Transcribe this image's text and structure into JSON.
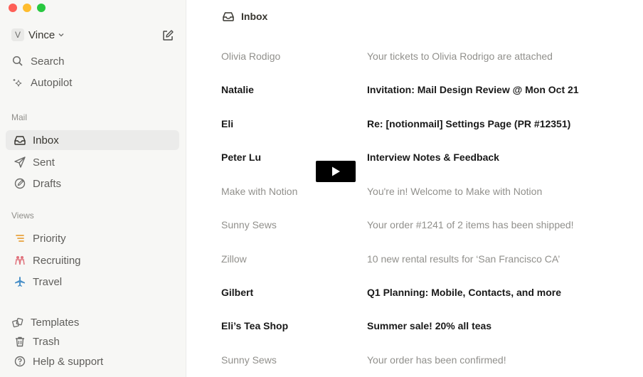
{
  "sidebar": {
    "account": {
      "initial": "V",
      "name": "Vince"
    },
    "top_items": [
      {
        "label": "Search",
        "icon": "search-icon"
      },
      {
        "label": "Autopilot",
        "icon": "sparkle-icon"
      }
    ],
    "mail_section": {
      "label": "Mail",
      "items": [
        {
          "label": "Inbox",
          "icon": "inbox-icon",
          "selected": true
        },
        {
          "label": "Sent",
          "icon": "paper-plane-icon"
        },
        {
          "label": "Drafts",
          "icon": "draft-pencil-icon"
        }
      ]
    },
    "views_section": {
      "label": "Views",
      "items": [
        {
          "label": "Priority",
          "icon": "priority-list-icon",
          "color": "#e8a33d"
        },
        {
          "label": "Recruiting",
          "icon": "people-icon",
          "color": "#e0737d"
        },
        {
          "label": "Travel",
          "icon": "airplane-icon",
          "color": "#4a90c8"
        }
      ]
    },
    "bottom_items": [
      {
        "label": "Templates",
        "icon": "templates-icon"
      },
      {
        "label": "Trash",
        "icon": "trash-icon"
      },
      {
        "label": "Help & support",
        "icon": "help-icon"
      }
    ]
  },
  "main": {
    "title": "Inbox",
    "messages": [
      {
        "sender": "Olivia Rodigo",
        "subject": "Your tickets to Olivia Rodrigo are attached",
        "unread": false
      },
      {
        "sender": "Natalie",
        "subject": "Invitation: Mail Design Review @ Mon Oct 21",
        "unread": true
      },
      {
        "sender": "Eli",
        "subject": "Re: [notionmail] Settings Page (PR #12351)",
        "unread": true
      },
      {
        "sender": "Peter Lu",
        "subject": "Interview Notes & Feedback",
        "unread": true
      },
      {
        "sender": "Make with Notion",
        "subject": "You're in! Welcome to Make with Notion",
        "unread": false
      },
      {
        "sender": "Sunny Sews",
        "subject": "Your order #1241 of 2 items has been shipped!",
        "unread": false
      },
      {
        "sender": "Zillow",
        "subject": "10 new rental results for ‘San Francisco CA’",
        "unread": false
      },
      {
        "sender": "Gilbert",
        "subject": "Q1 Planning: Mobile, Contacts, and more",
        "unread": true
      },
      {
        "sender": "Eli’s Tea Shop",
        "subject": "Summer sale! 20% all teas",
        "unread": true
      },
      {
        "sender": "Sunny Sews",
        "subject": "Your order has been confirmed!",
        "unread": false
      }
    ]
  },
  "video": {
    "icon": "play-icon"
  },
  "colors": {
    "sidebar_bg": "#f7f7f5",
    "selected_bg": "#ebebea",
    "unread_text": "#191919",
    "read_text": "#91908c"
  }
}
